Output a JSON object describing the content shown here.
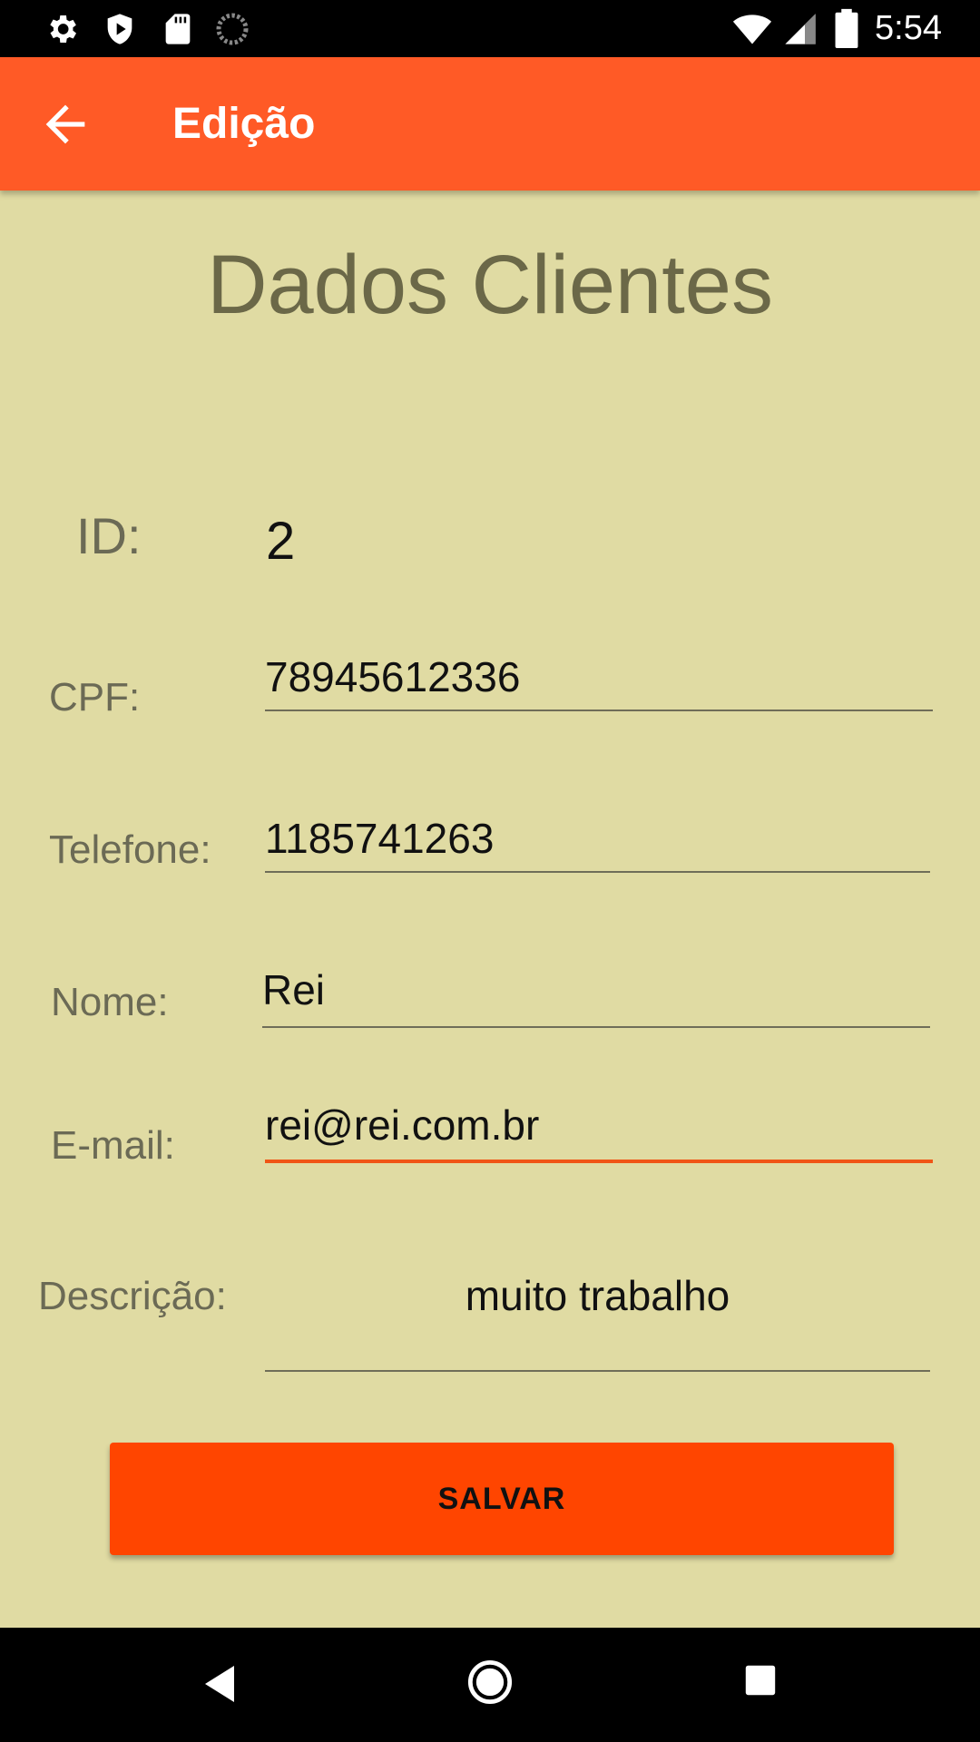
{
  "status_bar": {
    "time": "5:54",
    "left_icons": [
      "settings-icon",
      "shield-icon",
      "sd-card-icon",
      "sync-icon"
    ],
    "right_icons": [
      "wifi-icon",
      "signal-icon",
      "battery-icon"
    ]
  },
  "app_bar": {
    "back_icon": "arrow-back-icon",
    "title": "Edição",
    "color": "#ff5a26"
  },
  "form": {
    "title": "Dados Clientes",
    "id_label": "ID:",
    "id_value": "2",
    "cpf_label": "CPF:",
    "cpf_value": "78945612336",
    "telefone_label": "Telefone:",
    "telefone_value": "1185741263",
    "nome_label": "Nome:",
    "nome_value": "Rei",
    "email_label": "E-mail:",
    "email_value": "rei@rei.com.br",
    "descricao_label": "Descrição:",
    "descricao_value": "muito trabalho"
  },
  "save_button": {
    "label": "SALVAR",
    "color": "#ff4500"
  },
  "nav_bar": {
    "icons": [
      "back-triangle-icon",
      "home-circle-icon",
      "recents-square-icon"
    ]
  },
  "colors": {
    "background": "#e0dba3",
    "accent": "#f05516"
  }
}
